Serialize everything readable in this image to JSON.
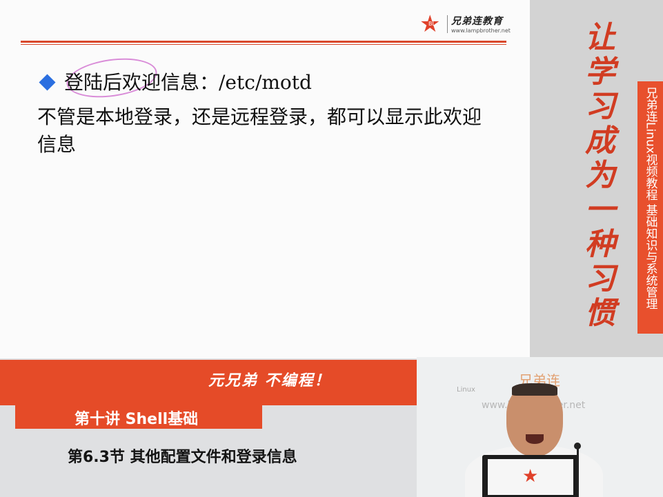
{
  "slide": {
    "logo": {
      "star_text": "BL",
      "brand": "兄弟连教育",
      "url": "www.lampbrother.net"
    },
    "heading": "登陆后欢迎信息：/etc/motd",
    "body": "不管是本地登录，还是远程登录，都可以显示此欢迎信息"
  },
  "right_banner": {
    "slogan": [
      "让",
      "学",
      "习",
      "成",
      "为",
      "一",
      "种",
      "习",
      "惯"
    ],
    "vertical_text": "兄弟连Linux视频教程  基础知识与系统管理"
  },
  "lower": {
    "motto": "元兄弟 不编程！",
    "lecture_title": "第十讲 Shell基础",
    "section_title": "第6.3节 其他配置文件和登录信息"
  },
  "video": {
    "brand": "兄弟连",
    "url": "www.lampbrother.net",
    "linux_label": "Linux"
  },
  "colors": {
    "accent": "#e54b28",
    "bullet": "#2b6fe0",
    "annotation": "#d98cd8"
  }
}
